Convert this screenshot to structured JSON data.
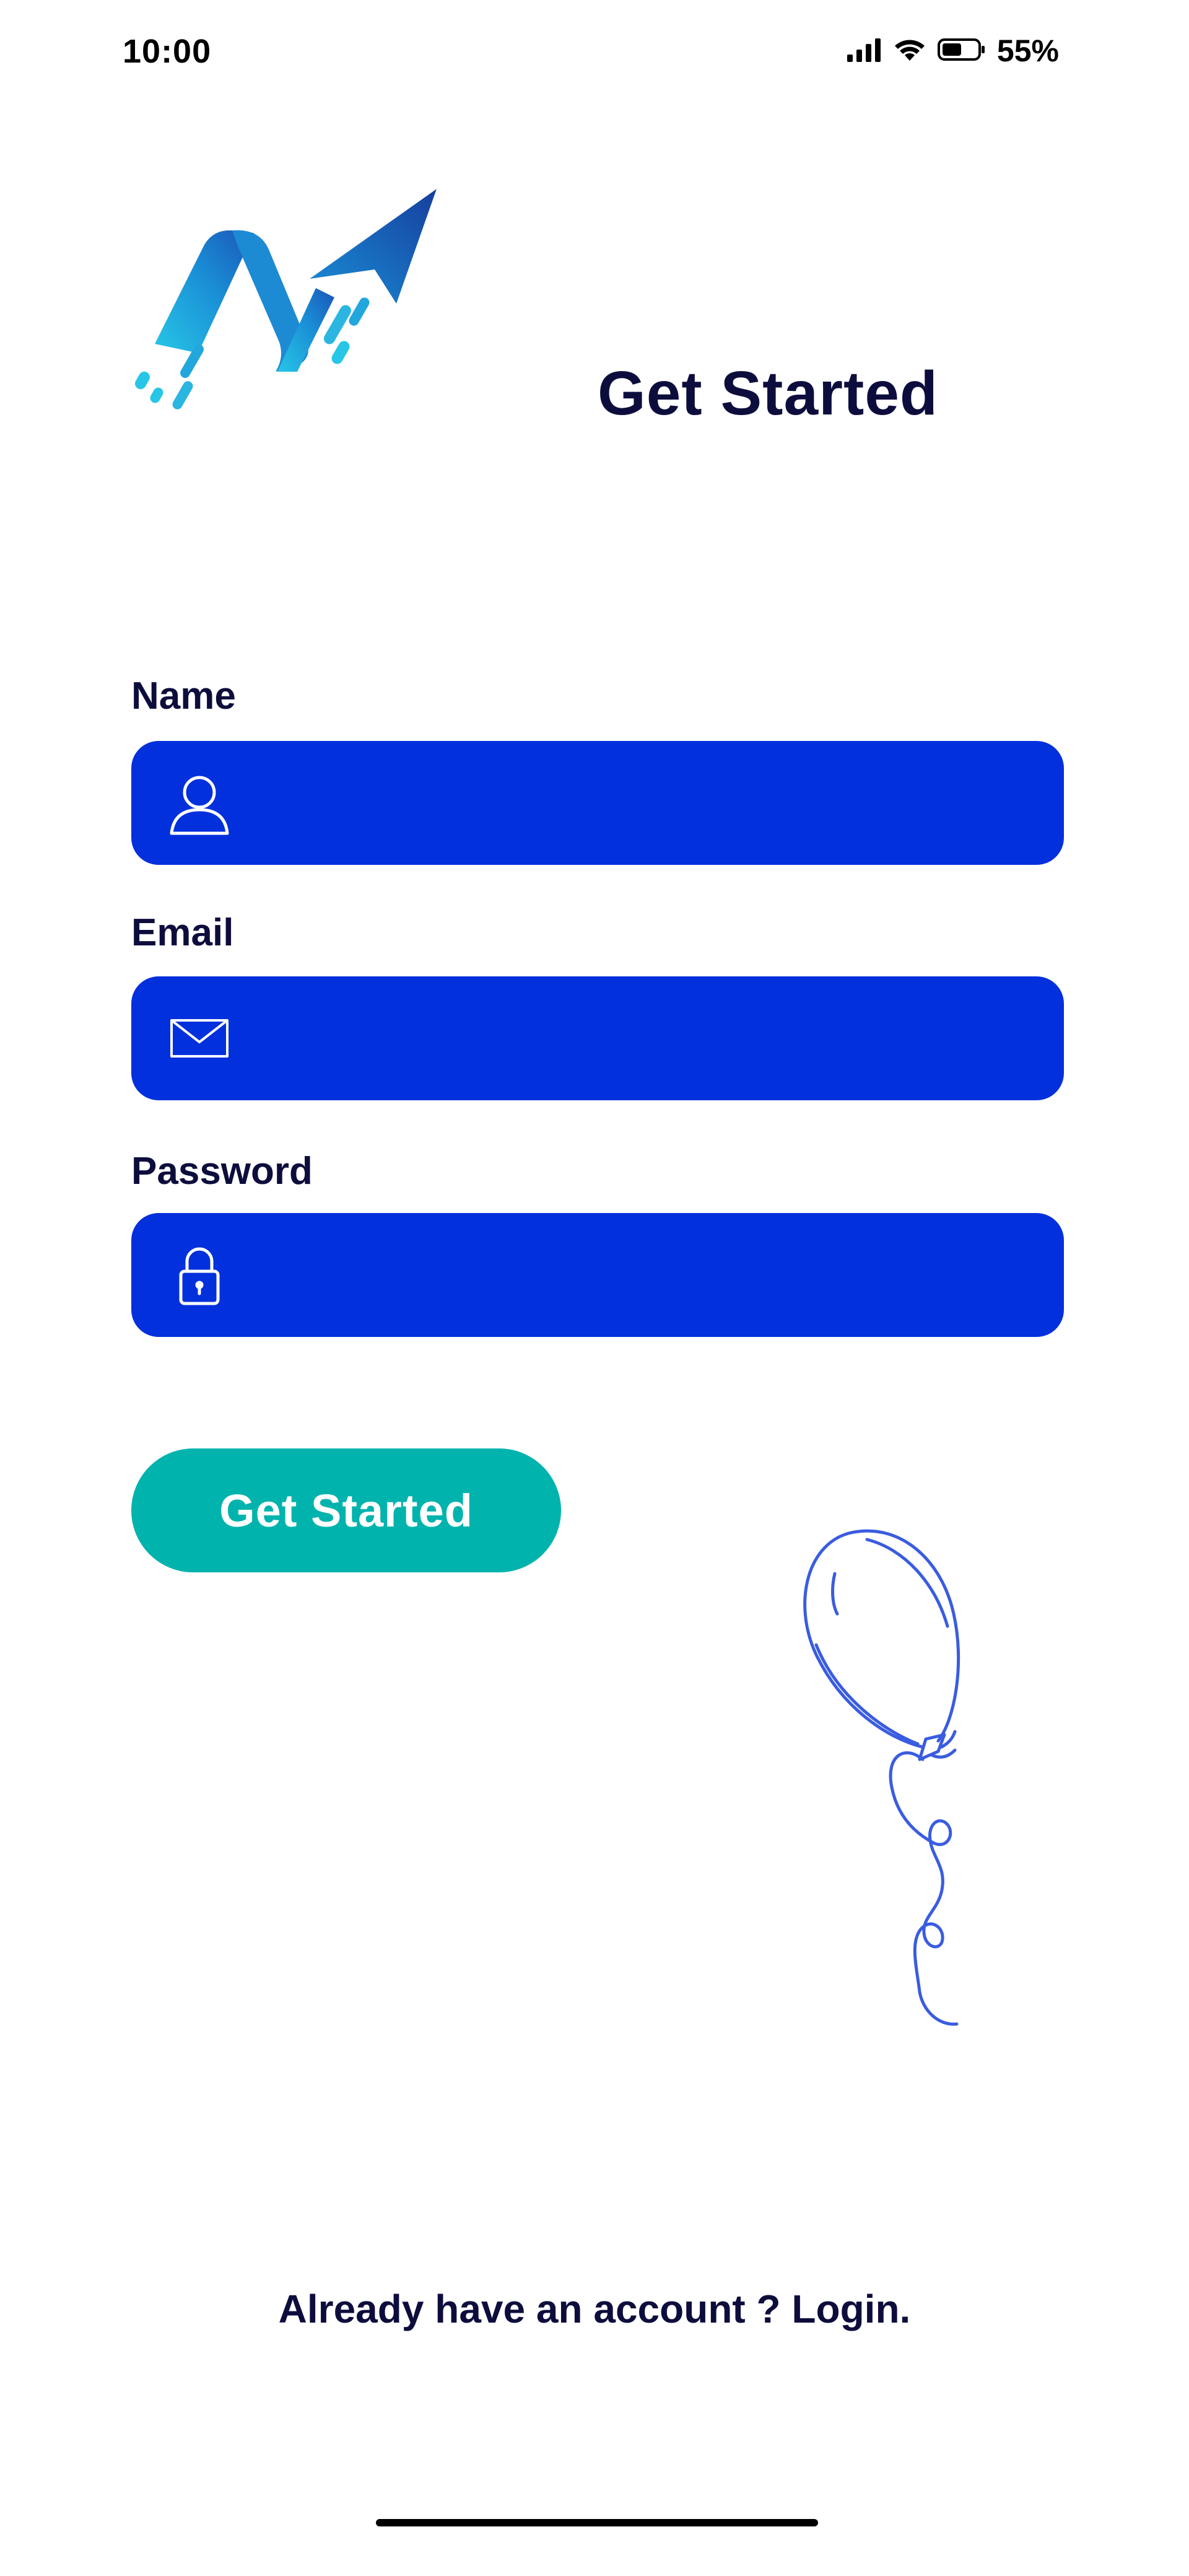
{
  "status_bar": {
    "time": "10:00",
    "battery_percent": "55%",
    "battery_level": 0.55,
    "icons": [
      "signal-icon",
      "wifi-icon",
      "battery-icon"
    ]
  },
  "header": {
    "logo": "logo-icon",
    "title": "Get Started"
  },
  "form": {
    "fields": [
      {
        "label": "Name",
        "value": "",
        "icon": "user-icon"
      },
      {
        "label": "Email",
        "value": "",
        "icon": "mail-icon"
      },
      {
        "label": "Password",
        "value": "",
        "icon": "lock-icon"
      }
    ],
    "submit_label": "Get Started"
  },
  "footer": {
    "login_prompt": "Already have an account ? Login."
  },
  "colors": {
    "field_background": "#0230dc",
    "button_background": "#00b3ad",
    "text_primary": "#0d0d3d",
    "balloon_stroke": "#3a5ce0"
  }
}
